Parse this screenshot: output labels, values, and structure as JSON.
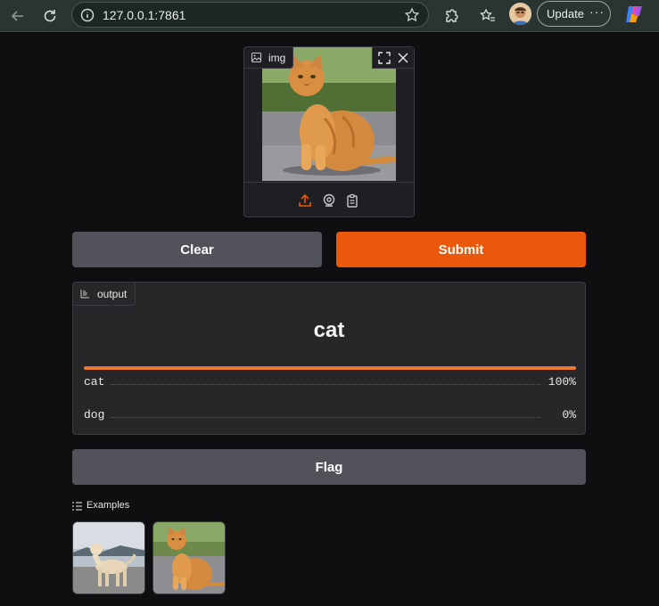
{
  "browser": {
    "url": "127.0.0.1:7861",
    "update_label": "Update",
    "more_label": "···"
  },
  "input_image": {
    "label": "img"
  },
  "buttons": {
    "clear": "Clear",
    "submit": "Submit",
    "flag": "Flag"
  },
  "output": {
    "label": "output",
    "predicted": "cat",
    "confidences": [
      {
        "label": "cat",
        "value": 1.0,
        "display": "100%"
      },
      {
        "label": "dog",
        "value": 0.0,
        "display": "0%"
      }
    ]
  },
  "examples": {
    "label": "Examples"
  },
  "colors": {
    "accent": "#ea580c",
    "button_gray": "#52525b",
    "panel": "#27272a",
    "background": "#0f0f11"
  }
}
